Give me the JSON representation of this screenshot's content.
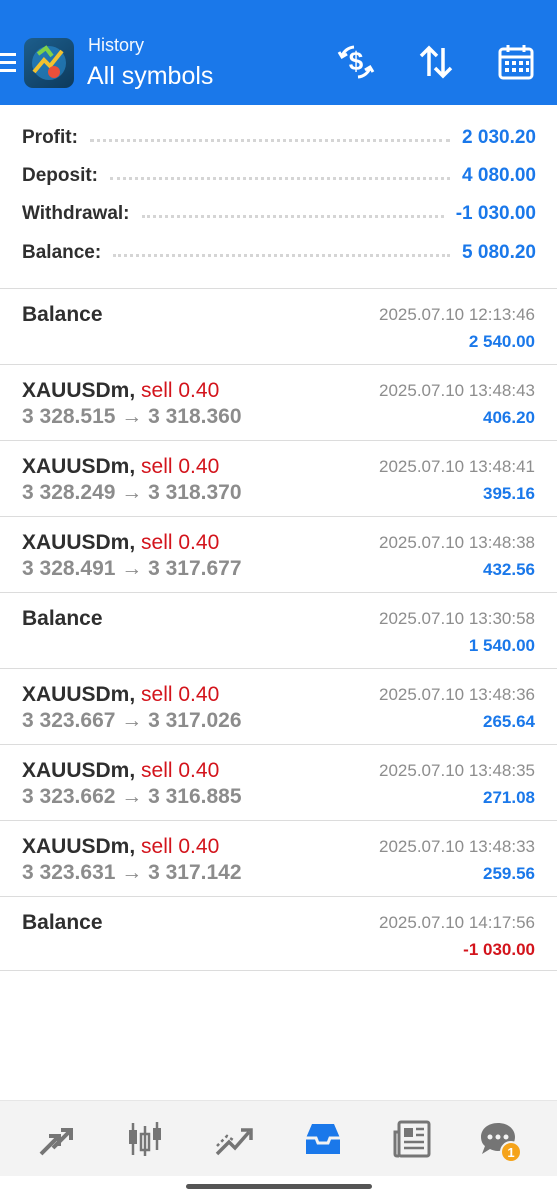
{
  "header": {
    "subtitle": "History",
    "title": "All symbols",
    "logo_icon": "metatrader-logo",
    "actions": [
      "currency-exchange-icon",
      "sort-icon",
      "calendar-icon"
    ]
  },
  "summary": {
    "profit": {
      "label": "Profit:",
      "value": "2 030.20"
    },
    "deposit": {
      "label": "Deposit:",
      "value": "4 080.00"
    },
    "withdrawal": {
      "label": "Withdrawal:",
      "value": "-1 030.00"
    },
    "balance": {
      "label": "Balance:",
      "value": "5 080.20"
    }
  },
  "history": [
    {
      "type": "balance",
      "title": "Balance",
      "time": "2025.07.10 12:13:46",
      "amount": "2 540.00",
      "negative": false
    },
    {
      "type": "trade",
      "symbol": "XAUUSDm,",
      "side": "sell 0.40",
      "prices": "3 328.515 → 3 318.360",
      "time": "2025.07.10 13:48:43",
      "amount": "406.20",
      "negative": false
    },
    {
      "type": "trade",
      "symbol": "XAUUSDm,",
      "side": "sell 0.40",
      "prices": "3 328.249 → 3 318.370",
      "time": "2025.07.10 13:48:41",
      "amount": "395.16",
      "negative": false
    },
    {
      "type": "trade",
      "symbol": "XAUUSDm,",
      "side": "sell 0.40",
      "prices": "3 328.491 → 3 317.677",
      "time": "2025.07.10 13:48:38",
      "amount": "432.56",
      "negative": false
    },
    {
      "type": "balance",
      "title": "Balance",
      "time": "2025.07.10 13:30:58",
      "amount": "1 540.00",
      "negative": false
    },
    {
      "type": "trade",
      "symbol": "XAUUSDm,",
      "side": "sell 0.40",
      "prices": "3 323.667 → 3 317.026",
      "time": "2025.07.10 13:48:36",
      "amount": "265.64",
      "negative": false
    },
    {
      "type": "trade",
      "symbol": "XAUUSDm,",
      "side": "sell 0.40",
      "prices": "3 323.662 → 3 316.885",
      "time": "2025.07.10 13:48:35",
      "amount": "271.08",
      "negative": false
    },
    {
      "type": "trade",
      "symbol": "XAUUSDm,",
      "side": "sell 0.40",
      "prices": "3 323.631 → 3 317.142",
      "time": "2025.07.10 13:48:33",
      "amount": "259.56",
      "negative": false
    },
    {
      "type": "balance",
      "title": "Balance",
      "time": "2025.07.10 14:17:56",
      "amount": "-1 030.00",
      "negative": true
    }
  ],
  "bottom_nav": {
    "items": [
      "quotes-icon",
      "chart-icon",
      "trade-icon",
      "history-icon",
      "news-icon",
      "messages-icon"
    ],
    "active": "history-icon",
    "messages_badge": "1"
  },
  "colors": {
    "accent": "#1a78ea",
    "sell": "#d3141c",
    "badge": "#f5a31a"
  }
}
